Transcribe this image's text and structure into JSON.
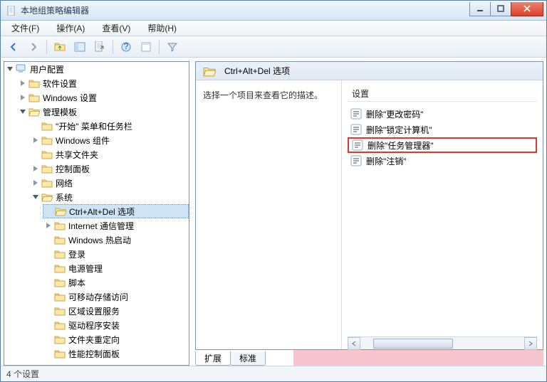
{
  "window": {
    "title": "本地组策略编辑器"
  },
  "menu": {
    "file": "文件(F)",
    "action": "操作(A)",
    "view": "查看(V)",
    "help": "帮助(H)"
  },
  "tree": {
    "root": "用户配置",
    "software": "软件设置",
    "windows_settings": "Windows 设置",
    "admin_templates": "管理模板",
    "start_menu": "\"开始\" 菜单和任务栏",
    "windows_components": "Windows 组件",
    "shared_folders": "共享文件夹",
    "control_panel": "控制面板",
    "network": "网络",
    "system": "系统",
    "ctrlaltdel": "Ctrl+Alt+Del 选项",
    "internet_comm": "Internet 通信管理",
    "windows_hotstart": "Windows 热启动",
    "logon": "登录",
    "power": "电源管理",
    "scripts": "脚本",
    "removable": "可移动存储访问",
    "locale": "区域设置服务",
    "driver_install": "驱动程序安装",
    "folder_redir": "文件夹重定向",
    "perf_cpl": "性能控制面板"
  },
  "right": {
    "heading": "Ctrl+Alt+Del 选项",
    "instruction": "选择一个项目来查看它的描述。",
    "settings_header": "设置",
    "items": [
      {
        "label": "删除\"更改密码\""
      },
      {
        "label": "删除\"锁定计算机\""
      },
      {
        "label": "删除\"任务管理器\"",
        "highlight": true
      },
      {
        "label": "删除\"注销\""
      }
    ]
  },
  "tabs": {
    "extended": "扩展",
    "standard": "标准"
  },
  "status": {
    "text": "4 个设置"
  }
}
